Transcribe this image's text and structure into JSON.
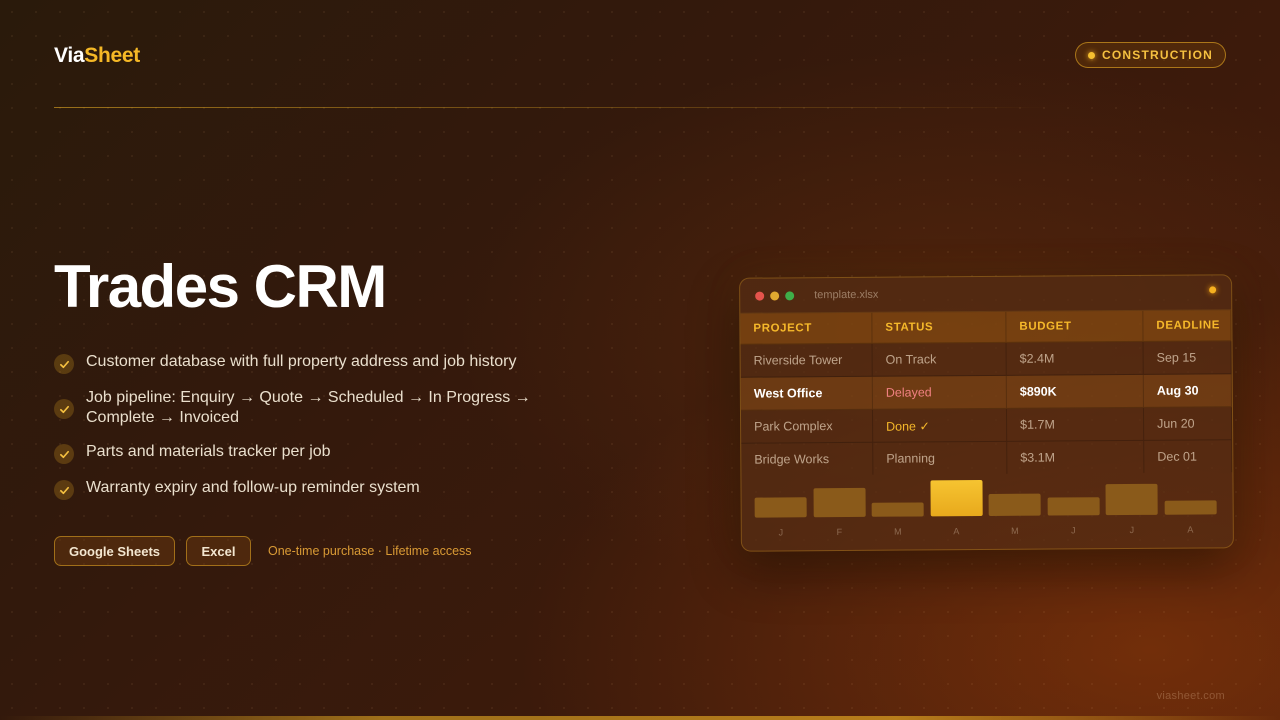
{
  "brand": {
    "part1": "Via",
    "part2": "Sheet"
  },
  "badge": {
    "label": "CONSTRUCTION"
  },
  "hero": {
    "title": "Trades CRM"
  },
  "features": [
    "Customer database with full property address and job history",
    "Job pipeline: Enquiry → Quote → Scheduled → In Progress → Complete → Invoiced",
    "Parts and materials tracker per job",
    "Warranty expiry and follow-up reminder system"
  ],
  "buttons": {
    "google_sheets": "Google Sheets",
    "excel": "Excel"
  },
  "purchase_note": "One-time purchase · Lifetime access",
  "footer": {
    "site": "viasheet.com"
  },
  "preview": {
    "filename": "template.xlsx",
    "columns": [
      "PROJECT",
      "STATUS",
      "BUDGET",
      "DEADLINE"
    ],
    "rows": [
      [
        "Riverside Tower",
        "On Track",
        "$2.4M",
        "Sep 15"
      ],
      [
        "West Office",
        "Delayed",
        "$890K",
        "Aug 30"
      ],
      [
        "Park Complex",
        "Done ✓",
        "$1.7M",
        "Jun 20"
      ],
      [
        "Bridge Works",
        "Planning",
        "$3.1M",
        "Dec 01"
      ]
    ],
    "highlighted_row": 1
  },
  "chart_data": {
    "type": "bar",
    "categories": [
      "J",
      "F",
      "M",
      "A",
      "M",
      "J",
      "J",
      "A"
    ],
    "values": [
      0.55,
      0.8,
      0.4,
      1.0,
      0.62,
      0.5,
      0.85,
      0.4
    ],
    "highlight_index": 3,
    "title": "",
    "xlabel": "",
    "ylabel": ""
  },
  "colors": {
    "accent": "#f5b826",
    "background": "#33190c",
    "bar": "#8a5a1a",
    "bar_highlight": "#f6c431",
    "delayed": "#f08080"
  }
}
